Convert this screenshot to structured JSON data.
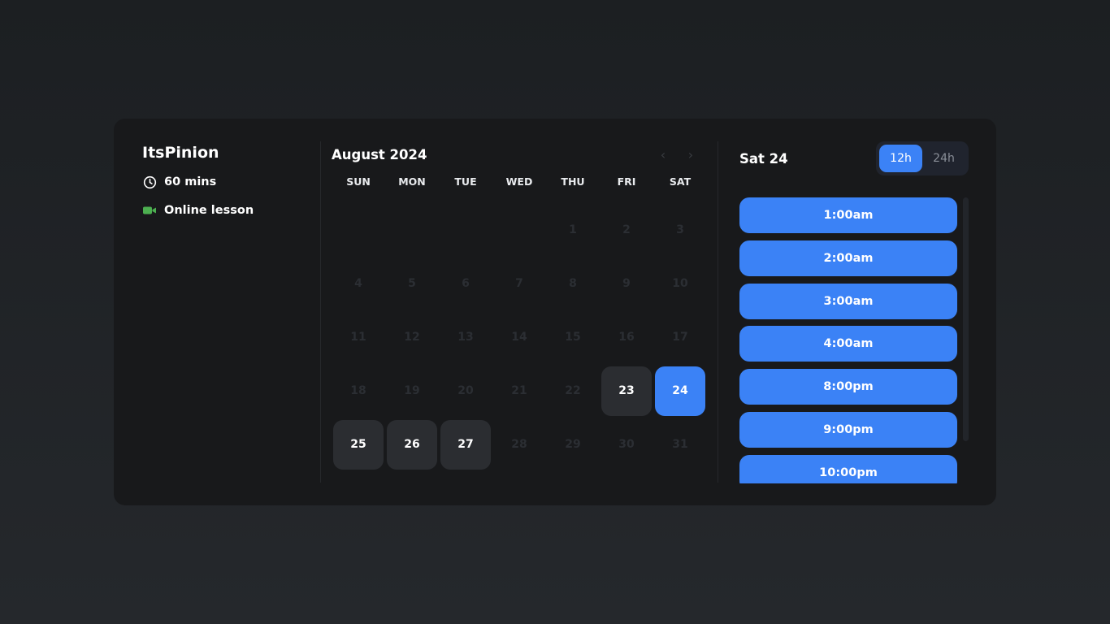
{
  "host": {
    "name": "ItsPinion",
    "duration": "60 mins",
    "location": "Online lesson"
  },
  "calendar": {
    "title": "August 2024",
    "weekdays": [
      "SUN",
      "MON",
      "TUE",
      "WED",
      "THU",
      "FRI",
      "SAT"
    ],
    "days": [
      "",
      "",
      "",
      "",
      "1",
      "2",
      "3",
      "4",
      "5",
      "6",
      "7",
      "8",
      "9",
      "10",
      "11",
      "12",
      "13",
      "14",
      "15",
      "16",
      "17",
      "18",
      "19",
      "20",
      "21",
      "22",
      "23",
      "24",
      "25",
      "26",
      "27",
      "28",
      "29",
      "30",
      "31"
    ]
  },
  "times": {
    "selected_date": "Sat 24",
    "format_12h": "12h",
    "format_24h": "24h",
    "slots": [
      "1:00am",
      "2:00am",
      "3:00am",
      "4:00am",
      "8:00pm",
      "9:00pm",
      "10:00pm"
    ]
  },
  "colors": {
    "accent": "#3b82f6",
    "available_day": "#2b2d31",
    "video_icon": "#4caf50"
  }
}
